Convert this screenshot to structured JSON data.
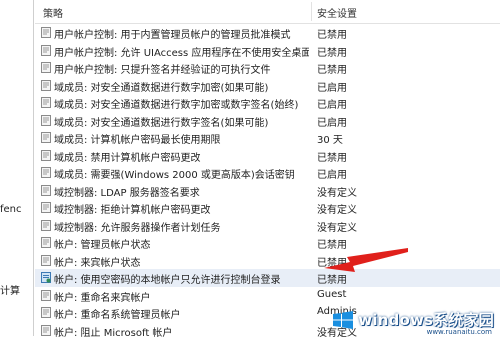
{
  "left_pane": {
    "fragments": [
      "fenc",
      "计算"
    ]
  },
  "columns": {
    "policy": "策略",
    "setting": "安全设置"
  },
  "rows": [
    {
      "policy": "用户帐户控制: 用于内置管理员帐户的管理员批准模式",
      "setting": "已禁用",
      "icon": "policy-icon"
    },
    {
      "policy": "用户帐户控制: 允许 UIAccess 应用程序在不使用安全桌面...",
      "setting": "已禁用",
      "icon": "policy-icon"
    },
    {
      "policy": "用户帐户控制: 只提升签名并经验证的可执行文件",
      "setting": "已禁用",
      "icon": "policy-icon"
    },
    {
      "policy": "域成员: 对安全通道数据进行数字加密(如果可能)",
      "setting": "已启用",
      "icon": "policy-icon"
    },
    {
      "policy": "域成员: 对安全通道数据进行数字加密或数字签名(始终)",
      "setting": "已启用",
      "icon": "policy-icon"
    },
    {
      "policy": "域成员: 对安全通道数据进行数字签名(如果可能)",
      "setting": "已启用",
      "icon": "policy-icon"
    },
    {
      "policy": "域成员: 计算机帐户密码最长使用期限",
      "setting": "30 天",
      "icon": "policy-icon"
    },
    {
      "policy": "域成员: 禁用计算机帐户密码更改",
      "setting": "已禁用",
      "icon": "policy-icon"
    },
    {
      "policy": "域成员: 需要强(Windows 2000 或更高版本)会话密钥",
      "setting": "已启用",
      "icon": "policy-icon"
    },
    {
      "policy": "域控制器: LDAP 服务器签名要求",
      "setting": "没有定义",
      "icon": "policy-icon"
    },
    {
      "policy": "域控制器: 拒绝计算机帐户密码更改",
      "setting": "没有定义",
      "icon": "policy-icon"
    },
    {
      "policy": "域控制器: 允许服务器操作者计划任务",
      "setting": "没有定义",
      "icon": "policy-icon"
    },
    {
      "policy": "帐户: 管理员帐户状态",
      "setting": "已禁用",
      "icon": "policy-icon"
    },
    {
      "policy": "帐户: 来宾帐户状态",
      "setting": "已禁用",
      "icon": "policy-icon"
    },
    {
      "policy": "帐户: 使用空密码的本地帐户只允许进行控制台登录",
      "setting": "已禁用",
      "icon": "policy-icon-selected"
    },
    {
      "policy": "帐户: 重命名来宾帐户",
      "setting": "Guest",
      "icon": "policy-icon"
    },
    {
      "policy": "帐户: 重命名系统管理员帐户",
      "setting": "Adminis",
      "icon": "policy-icon"
    },
    {
      "policy": "帐户: 阻止 Microsoft 帐户",
      "setting": "没有定义",
      "icon": "policy-icon"
    }
  ],
  "selected_row_index": 14,
  "annotation": {
    "color": "#e0201b"
  },
  "watermark": {
    "main": "windows系统家园",
    "sub": "",
    "url": "www.ruanaitu.com"
  },
  "colors": {
    "selected_row": "#e8eef7",
    "arrow": "#e0201b",
    "watermark_outline": "#1a4f8a"
  }
}
